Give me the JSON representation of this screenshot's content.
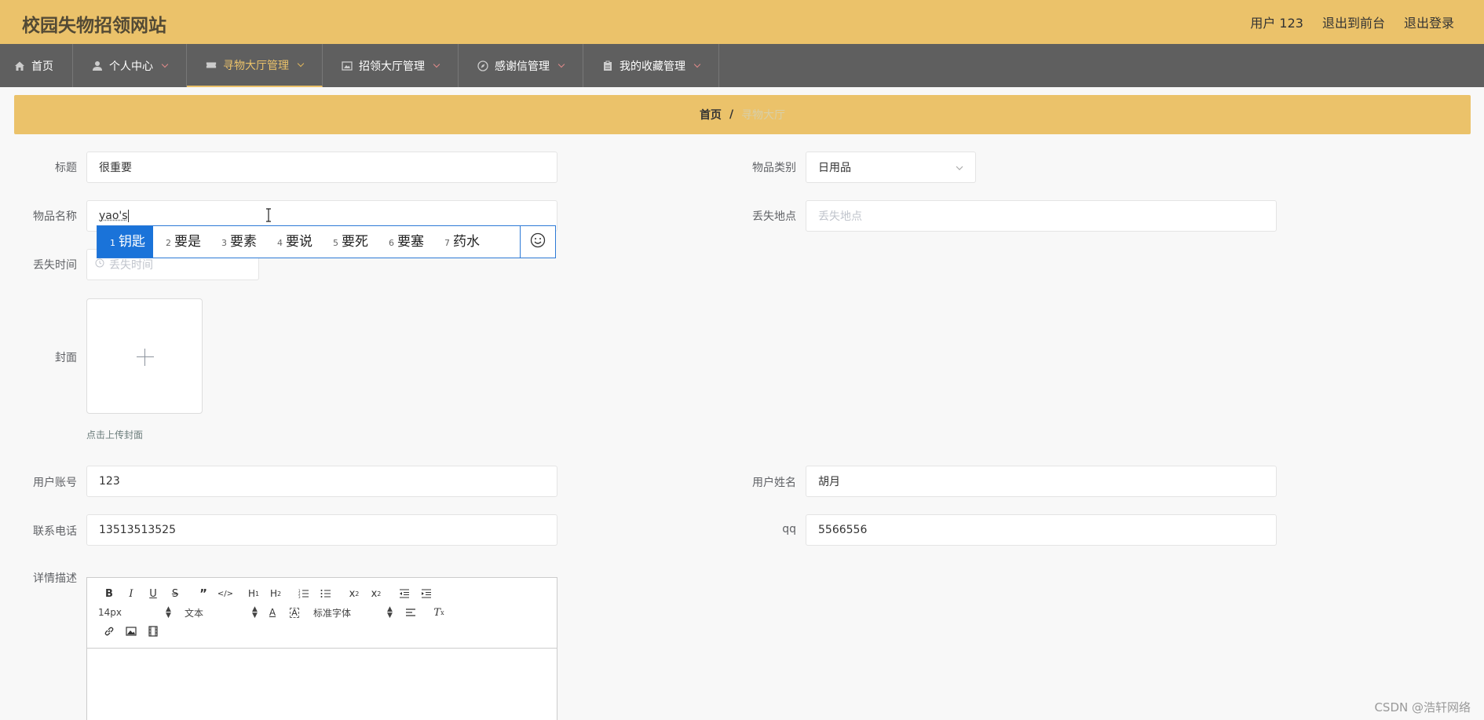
{
  "header": {
    "title": "校园失物招领网站",
    "user": "用户 123",
    "back_front": "退出到前台",
    "logout": "退出登录"
  },
  "nav": [
    {
      "label": "首页",
      "icon": "home-icon",
      "caret": false,
      "active": false
    },
    {
      "label": "个人中心",
      "icon": "user-icon",
      "caret": true,
      "active": false
    },
    {
      "label": "寻物大厅管理",
      "icon": "ticket-icon",
      "caret": true,
      "active": true
    },
    {
      "label": "招领大厅管理",
      "icon": "picture-icon",
      "caret": true,
      "active": false
    },
    {
      "label": "感谢信管理",
      "icon": "compass-icon",
      "caret": true,
      "active": false
    },
    {
      "label": "我的收藏管理",
      "icon": "clipboard-icon",
      "caret": true,
      "active": false
    }
  ],
  "breadcrumb": {
    "home": "首页",
    "sep": "/",
    "current": "寻物大厅"
  },
  "form": {
    "title_label": "标题",
    "title_value": "很重要",
    "category_label": "物品类别",
    "category_value": "日用品",
    "name_label": "物品名称",
    "name_value": "yao's",
    "place_label": "丢失地点",
    "place_placeholder": "丢失地点",
    "time_label": "丢失时间",
    "time_placeholder": "丢失时间",
    "cover_label": "封面",
    "cover_hint": "点击上传封面",
    "account_label": "用户账号",
    "account_value": "123",
    "username_label": "用户姓名",
    "username_value": "胡月",
    "phone_label": "联系电话",
    "phone_value": "13513513525",
    "qq_label": "qq",
    "qq_value": "5566556",
    "detail_label": "详情描述"
  },
  "ime": {
    "candidates": [
      {
        "num": "1",
        "text": "钥匙"
      },
      {
        "num": "2",
        "text": "要是"
      },
      {
        "num": "3",
        "text": "要素"
      },
      {
        "num": "4",
        "text": "要说"
      },
      {
        "num": "5",
        "text": "要死"
      },
      {
        "num": "6",
        "text": "要塞"
      },
      {
        "num": "7",
        "text": "药水"
      }
    ],
    "selected_index": 0
  },
  "editor": {
    "font_size": "14px",
    "paragraph": "文本",
    "font_family": "标准字体",
    "buttons_row1": [
      "B",
      "I",
      "U",
      "S",
      "99",
      "</>",
      "H1",
      "H2",
      "ol",
      "ul",
      "x2",
      "x²",
      "outdent",
      "indent"
    ],
    "buttons_row3": [
      "link",
      "image",
      "video"
    ]
  },
  "watermark": "CSDN @浩轩网络",
  "colors": {
    "primary": "#ebc26a",
    "nav_bg": "#5f5f5f",
    "ime_blue": "#1a73d9"
  }
}
